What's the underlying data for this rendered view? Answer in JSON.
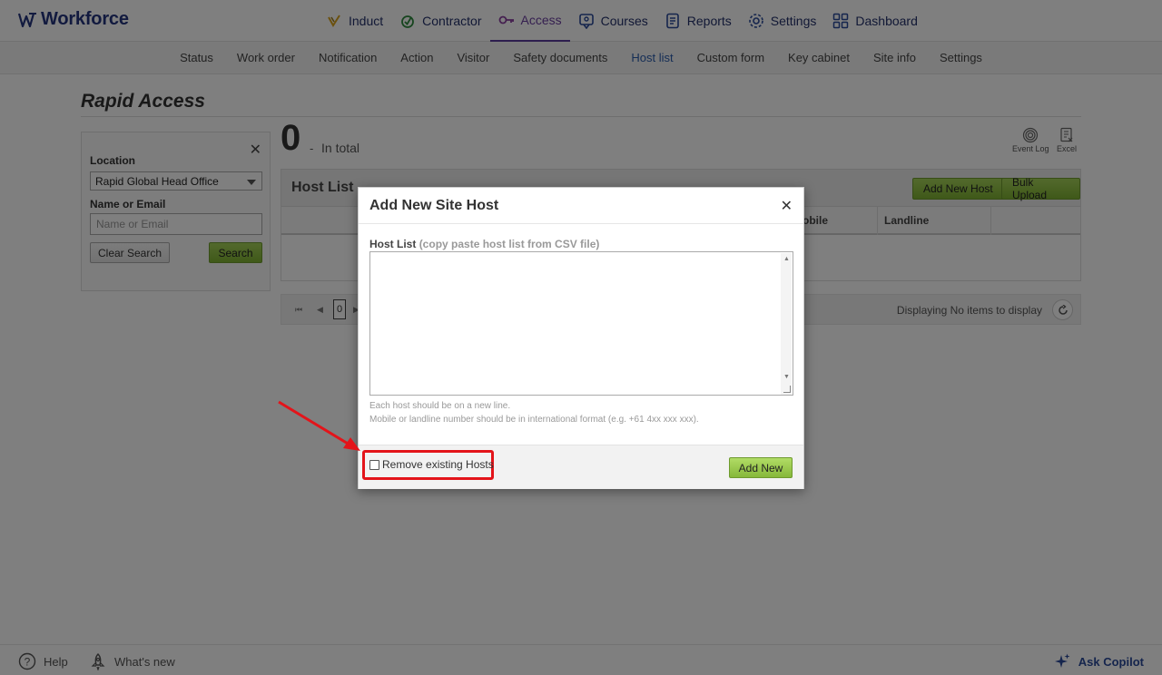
{
  "app": {
    "logo_text": "Workforce"
  },
  "main_nav": [
    {
      "label": "Induct",
      "icon": "induct-check-icon"
    },
    {
      "label": "Contractor",
      "icon": "contractor-icon"
    },
    {
      "label": "Access",
      "icon": "key-icon",
      "active": true
    },
    {
      "label": "Courses",
      "icon": "courses-icon"
    },
    {
      "label": "Reports",
      "icon": "reports-icon"
    },
    {
      "label": "Settings",
      "icon": "gear-icon"
    },
    {
      "label": "Dashboard",
      "icon": "dashboard-grid-icon"
    }
  ],
  "sub_nav": [
    "Status",
    "Work order",
    "Notification",
    "Action",
    "Visitor",
    "Safety documents",
    "Host list",
    "Custom form",
    "Key cabinet",
    "Site info",
    "Settings"
  ],
  "sub_nav_active": "Host list",
  "page": {
    "title": "Rapid Access",
    "count": "0",
    "count_dash": "-",
    "count_label": "In total",
    "event_log_label": "Event Log",
    "excel_label": "Excel"
  },
  "filter": {
    "close": "✕",
    "location_label": "Location",
    "location_value": "Rapid Global Head Office",
    "name_label": "Name or Email",
    "name_placeholder": "Name or Email",
    "clear_label": "Clear Search",
    "search_label": "Search"
  },
  "grid": {
    "title": "Host List",
    "add_host_label": "Add New Host",
    "bulk_upload_label": "Bulk Upload",
    "col_mobile": "obile",
    "col_landline": "Landline"
  },
  "pager": {
    "first": "⏮",
    "prev": "◀",
    "page": "0",
    "next": "▶",
    "info": "Displaying No items to display"
  },
  "modal": {
    "title": "Add New Site Host",
    "close": "✕",
    "field_label": "Host List",
    "field_hint": "(copy paste host list from CSV file)",
    "help_1": "Each host should be on a new line.",
    "help_2": "Mobile or landline number should be in international format (e.g. +61 4xx xxx xxx).",
    "remove_label": "Remove existing Hosts",
    "remove_checked": false,
    "add_new_label": "Add New"
  },
  "bottom_bar": {
    "help_label": "Help",
    "whats_new_label": "What's new",
    "copilot_label": "Ask Copilot"
  },
  "colors": {
    "brand": "#24357e",
    "active_nav": "#6b3fa0",
    "accent_green": "#86b83a",
    "annotation_red": "#e3141a"
  }
}
